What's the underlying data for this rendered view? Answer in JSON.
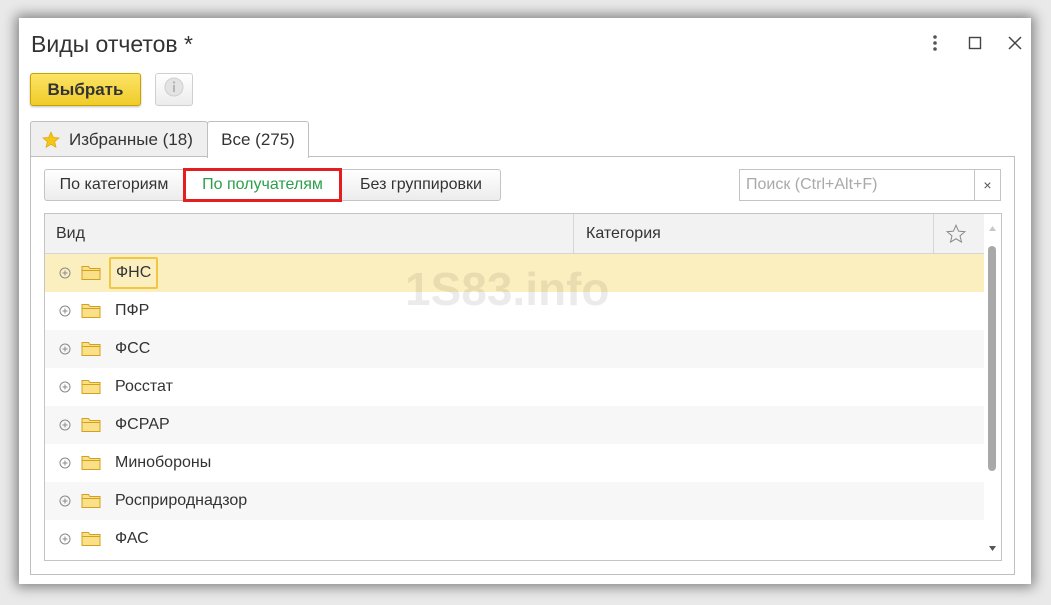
{
  "window": {
    "title": "Виды отчетов *"
  },
  "toolbar": {
    "select_label": "Выбрать"
  },
  "tabs": [
    {
      "label": "Избранные (18)"
    },
    {
      "label": "Все (275)"
    }
  ],
  "grouping": {
    "by_category": "По категориям",
    "by_recipient": "По получателям",
    "no_grouping": "Без группировки"
  },
  "search": {
    "placeholder": "Поиск (Ctrl+Alt+F)",
    "value": "",
    "clear": "×"
  },
  "table": {
    "columns": {
      "kind": "Вид",
      "category": "Категория"
    },
    "rows": [
      {
        "label": "ФНС"
      },
      {
        "label": "ПФР"
      },
      {
        "label": "ФСС"
      },
      {
        "label": "Росстат"
      },
      {
        "label": "ФСРАР"
      },
      {
        "label": "Минобороны"
      },
      {
        "label": "Росприроднадзор"
      },
      {
        "label": "ФАС"
      }
    ]
  },
  "watermark": "1S83.info",
  "colors": {
    "accent_yellow": "#f5d53c",
    "highlight_red": "#e41e1e",
    "active_green": "#2c9f4b",
    "selected_row": "#fcefbf"
  }
}
